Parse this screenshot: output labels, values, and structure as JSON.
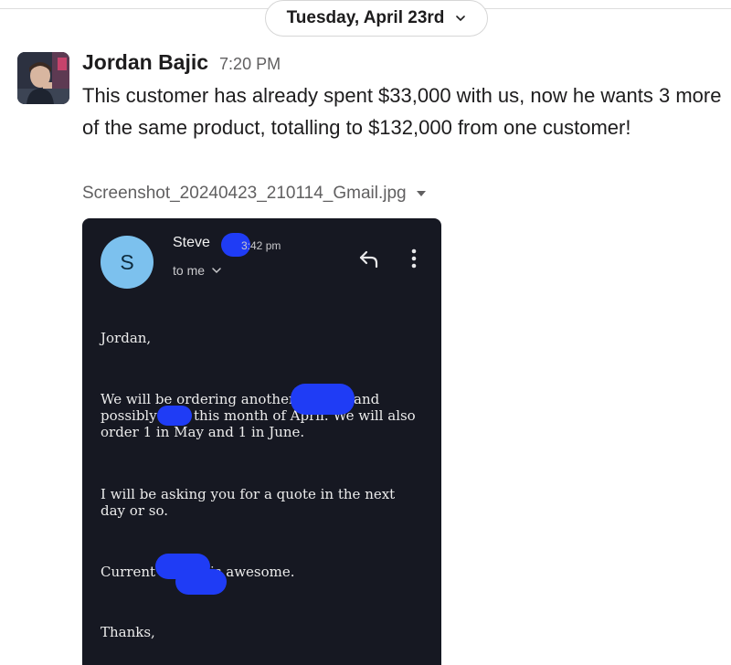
{
  "date_divider": {
    "label": "Tuesday, April 23rd"
  },
  "message": {
    "sender": "Jordan Bajic",
    "time": "7:20 PM",
    "text": "This customer has already spent $33,000 with us, now he wants 3 more of the same product, totalling to $132,000 from one customer!"
  },
  "attachment": {
    "filename": "Screenshot_20240423_210114_Gmail.jpg"
  },
  "email": {
    "avatar_letter": "S",
    "sender": "Steve",
    "time": "3:42 pm",
    "to": "to me",
    "greeting": "Jordan,",
    "order_part1": "We will be ordering another",
    "order_part2": "and",
    "order_part3": "possibly",
    "order_part4": "this month of April. We will also",
    "order_part5": "order 1 in May and 1 in June.",
    "quote_text": "I will be asking you for a quote in the next day or so.",
    "current_part1": "Current",
    "current_part2": "is awesome.",
    "thanks": "Thanks,"
  },
  "colors": {
    "email_background": "#161822",
    "email_avatar": "#7cc1ee",
    "redaction": "#1f3cf5",
    "muted_text": "#616061"
  },
  "icons": [
    "chevron-down-icon",
    "caret-down-icon",
    "reply-icon",
    "more-vertical-icon"
  ]
}
